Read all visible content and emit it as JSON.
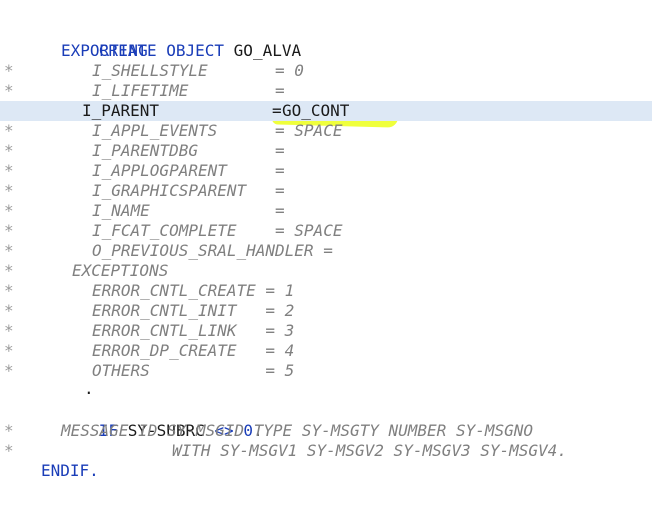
{
  "editor": {
    "lines": {
      "l1": {
        "kw1": "CREATE",
        "kw2": "OBJECT",
        "obj": "GO_ALVA"
      },
      "l2": {
        "kw": "EXPORTING"
      },
      "l3": {
        "mark": "*",
        "text": "I_SHELLSTYLE       = 0"
      },
      "l4": {
        "mark": "*",
        "text": "I_LIFETIME         ="
      },
      "l5": {
        "name": "I_PARENT",
        "eq": "=",
        "value": "GO_CONT"
      },
      "l6": {
        "mark": "*",
        "text": "I_APPL_EVENTS      = SPACE"
      },
      "l7": {
        "mark": "*",
        "text": "I_PARENTDBG        ="
      },
      "l8": {
        "mark": "*",
        "text": "I_APPLOGPARENT     ="
      },
      "l9": {
        "mark": "*",
        "text": "I_GRAPHICSPARENT   ="
      },
      "l10": {
        "mark": "*",
        "text": "I_NAME             ="
      },
      "l11": {
        "mark": "*",
        "text": "I_FCAT_COMPLETE    = SPACE"
      },
      "l12": {
        "mark": "*",
        "text": "O_PREVIOUS_SRAL_HANDLER ="
      },
      "l13": {
        "mark": "*",
        "text": "EXCEPTIONS"
      },
      "l14": {
        "mark": "*",
        "text": "ERROR_CNTL_CREATE = 1"
      },
      "l15": {
        "mark": "*",
        "text": "ERROR_CNTL_INIT   = 2"
      },
      "l16": {
        "mark": "*",
        "text": "ERROR_CNTL_LINK   = 3"
      },
      "l17": {
        "mark": "*",
        "text": "ERROR_DP_CREATE   = 4"
      },
      "l18": {
        "mark": "*",
        "text": "OTHERS            = 5"
      },
      "l19": {
        "text": "."
      },
      "l20": {
        "kw": "IF",
        "var": "SY-SUBRC",
        "op": "<>",
        "num": "0",
        "dot": "."
      },
      "l21": {
        "mark": "*",
        "text": "MESSAGE ID SY-MSGID TYPE SY-MSGTY NUMBER SY-MSGNO"
      },
      "l22": {
        "mark": "*",
        "text": "WITH SY-MSGV1 SY-MSGV2 SY-MSGV3 SY-MSGV4."
      },
      "l23": {
        "kw": "ENDIF."
      }
    }
  },
  "colors": {
    "keyword": "#1a3db8",
    "comment": "#808080",
    "current_line": "#dde8f5",
    "highlighter": "#ecff1a"
  }
}
